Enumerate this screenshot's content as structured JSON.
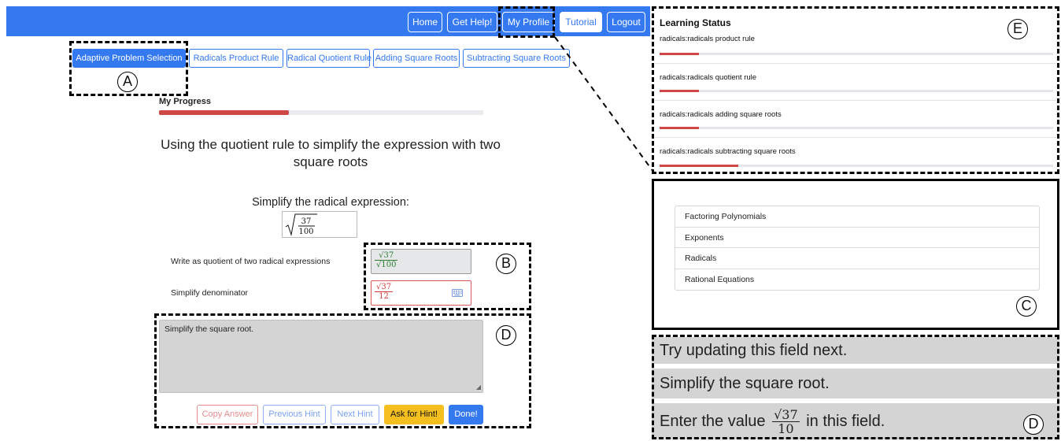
{
  "navbar": {
    "buttons": [
      "Home",
      "Get Help!",
      "My Profile",
      "Tutorial",
      "Logout"
    ],
    "accent": "#3479f0"
  },
  "tabs": [
    "Adaptive Problem Selection",
    "Radicals Product Rule",
    "Radical Quotient Rule",
    "Adding Square Roots",
    "Subtracting Square Roots"
  ],
  "progress": {
    "label": "My Progress",
    "fraction": 0.4
  },
  "problem": {
    "title": "Using the quotient rule to simplify the expression with two square roots",
    "subtitle": "Simplify the radical expression:",
    "expression": {
      "radicand_num": "37",
      "radicand_den": "100"
    }
  },
  "steps": [
    {
      "label": "Write as quotient of two radical expressions",
      "answer_num": "√37",
      "answer_den": "√100",
      "state": "correct"
    },
    {
      "label": "Simplify denominator",
      "answer_num": "√37",
      "answer_den": "12",
      "state": "incorrect"
    }
  ],
  "hint_box": {
    "text": "Simplify the square root."
  },
  "hint_buttons": [
    "Copy Answer",
    "Previous Hint",
    "Next Hint",
    "Ask for Hint!",
    "Done!"
  ],
  "annotations": {
    "a": "A",
    "b": "B",
    "c": "C",
    "d": "D",
    "e": "E"
  },
  "learning_status": {
    "title": "Learning Status",
    "skills": [
      {
        "name": "radicals:radicals product rule",
        "mastery": 0.1
      },
      {
        "name": "radicals:radicals quotient rule",
        "mastery": 0.1
      },
      {
        "name": "radicals:radicals adding square roots",
        "mastery": 0.1
      },
      {
        "name": "radicals:radicals subtracting square roots",
        "mastery": 0.2
      }
    ]
  },
  "topics": [
    "Factoring Polynomials",
    "Exponents",
    "Radicals",
    "Rational Equations"
  ],
  "hint_messages": {
    "m1": "Try updating this field next.",
    "m2": "Simplify the square root.",
    "m3_prefix": "Enter the value",
    "m3_num": "√37",
    "m3_den": "10",
    "m3_suffix": "in this field."
  }
}
